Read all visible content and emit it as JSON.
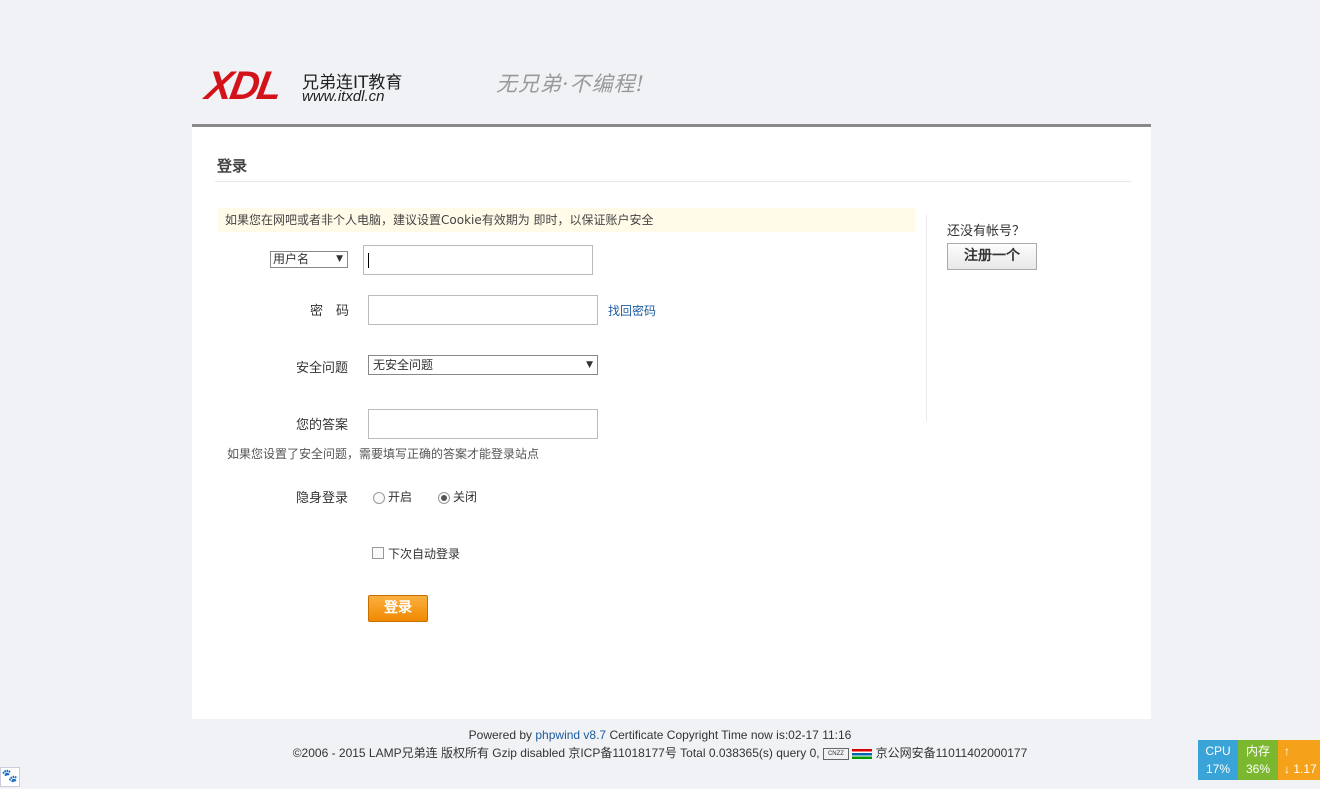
{
  "header": {
    "logo_mark": "XDL",
    "logo_cn": "兄弟连IT教育",
    "logo_url": "www.itxdl.cn",
    "slogan": "无兄弟·不编程!"
  },
  "main": {
    "title": "登录",
    "notice": "如果您在网吧或者非个人电脑，建议设置Cookie有效期为 即时，以保证账户安全",
    "username_type": "用户名",
    "username_value": "",
    "password_label": "密　码",
    "password_value": "",
    "forgot_link": "找回密码",
    "security_label": "安全问题",
    "security_value": "无安全问题",
    "answer_label": "您的答案",
    "answer_value": "",
    "answer_hint": "如果您设置了安全问题，需要填写正确的答案才能登录站点",
    "stealth_label": "隐身登录",
    "stealth_on": "开启",
    "stealth_off": "关闭",
    "auto_login": "下次自动登录",
    "login_button": "登录"
  },
  "side": {
    "question": "还没有帐号？",
    "register_button": "注册一个"
  },
  "footer": {
    "powered_prefix": "Powered by",
    "powered_link": "phpwind v8.7",
    "powered_suffix": "Certificate Copyright Time now is:02-17 11:16",
    "copyright": "©2006 - 2015 LAMP兄弟连 版权所有 Gzip disabled 京ICP备11018177号 Total 0.038365(s) query 0,",
    "cnzz": "CNZZ",
    "police": "京公网安备11011402000177"
  },
  "monitor": {
    "cpu_label": "CPU",
    "cpu_value": "17%",
    "mem_label": "内存",
    "mem_value": "36%",
    "up_icon": "↑",
    "down_icon": "↓",
    "net_value": "1.17",
    "colors": {
      "cpu": "#3aa3d8",
      "mem": "#7cb82f",
      "net": "#f5a21a"
    }
  }
}
